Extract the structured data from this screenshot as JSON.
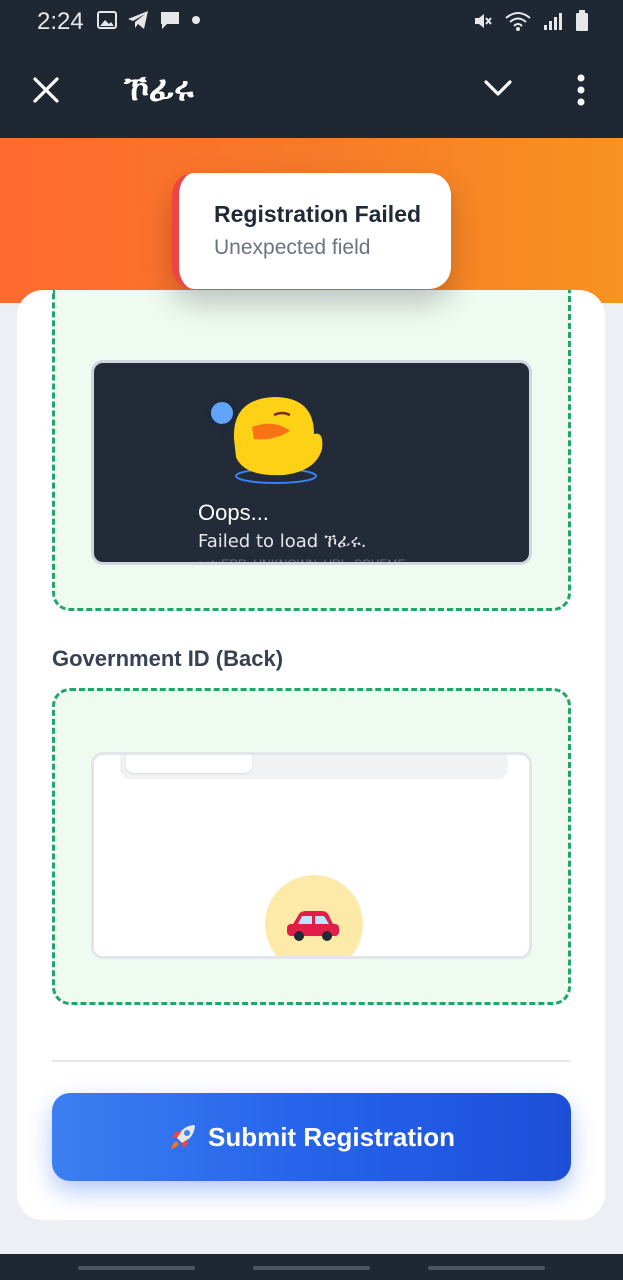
{
  "status_bar": {
    "time": "2:24",
    "icons_left": [
      "image-icon",
      "telegram-icon",
      "message-icon",
      "dot-icon"
    ],
    "icons_right": [
      "mute-icon",
      "wifi-icon",
      "signal-icon",
      "battery-icon"
    ]
  },
  "app_bar": {
    "title": "ኾፊሩ",
    "icons": [
      "close-icon",
      "chevron-down-icon",
      "more-vertical-icon"
    ]
  },
  "toast": {
    "title": "Registration Failed",
    "message": "Unexpected field"
  },
  "front_preview": {
    "heading": "Oops...",
    "message": "Failed to load ኾፊሩ.",
    "error_code": "net::ERR_UNKNOWN_URL_SCHEME"
  },
  "back_section": {
    "label": "Government ID (Back)",
    "preview_icon": "car-icon"
  },
  "submit": {
    "icon": "rocket-icon",
    "label": "Submit Registration"
  },
  "colors": {
    "header_bg": "#1f2733",
    "banner_start": "#ff6a2e",
    "banner_end": "#f7931f",
    "dropzone_border": "#22a56b",
    "button_start": "#3b7ff0",
    "button_end": "#1d4ed8",
    "toast_accent": "#ef4444"
  }
}
